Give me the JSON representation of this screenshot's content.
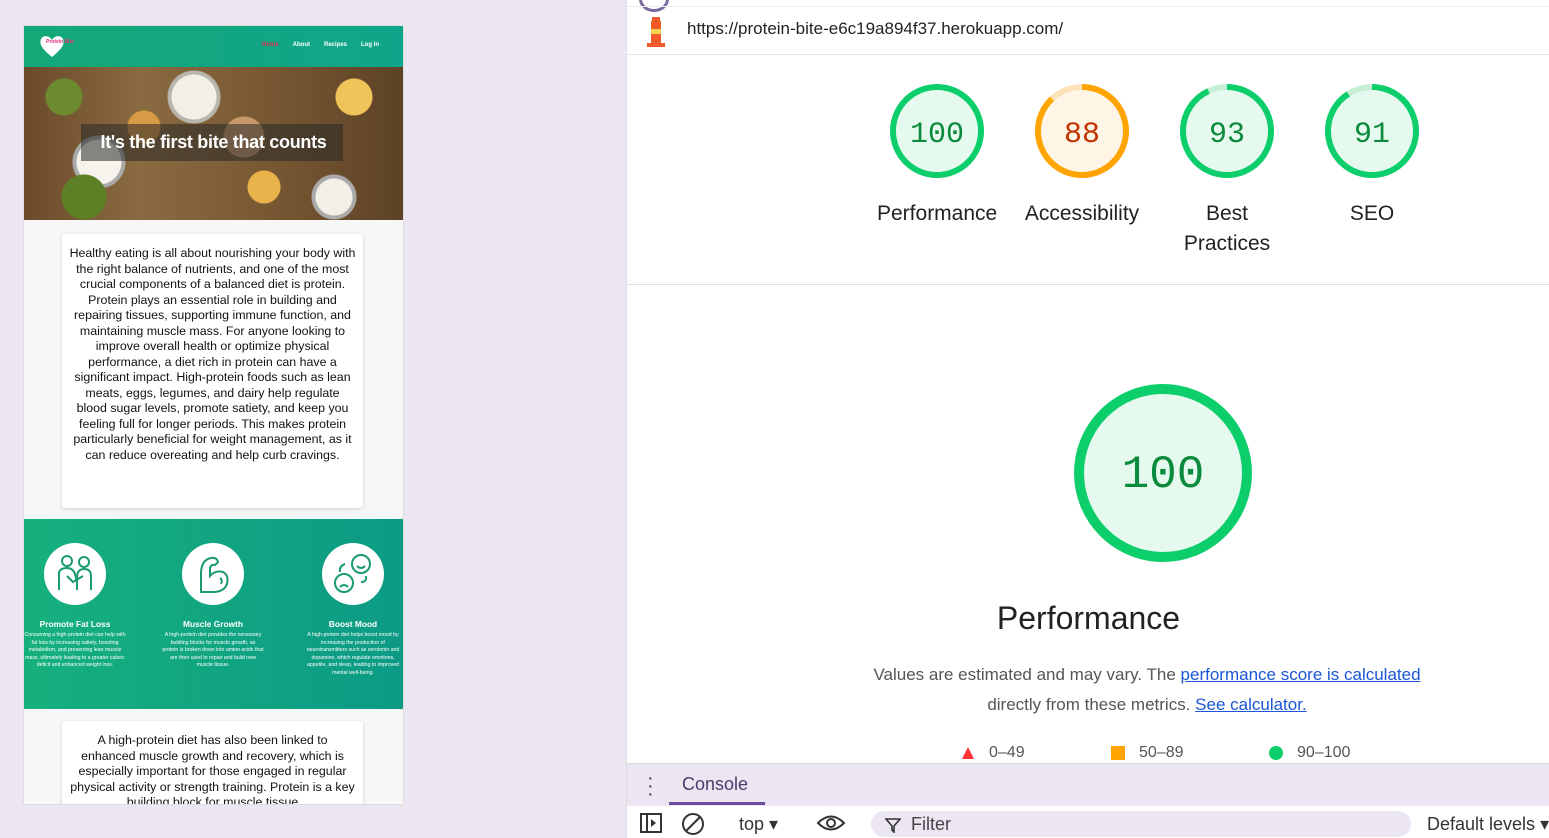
{
  "site": {
    "logo_text": "Protein Bite",
    "nav": [
      "Home",
      "About",
      "Recipes",
      "Log In"
    ],
    "hero_title": "It's the first bite that counts",
    "intro": "Healthy eating is all about nourishing your body with the right balance of nutrients, and one of the most crucial components of a balanced diet is protein. Protein plays an essential role in building and repairing tissues, supporting immune function, and maintaining muscle mass. For anyone looking to improve overall health or optimize physical performance, a diet rich in protein can have a significant impact. High-protein foods such as lean meats, eggs, legumes, and dairy help regulate blood sugar levels, promote satiety, and keep you feeling full for longer periods. This makes protein particularly beneficial for weight management, as it can reduce overeating and help curb cravings.",
    "benefits": [
      {
        "title": "Promote Fat Loss",
        "text": "Consuming a high-protein diet can help with fat loss by increasing satiety, boosting metabolism, and preserving lean muscle mass, ultimately leading to a greater caloric deficit and enhanced weight loss.",
        "icon": "people-icon"
      },
      {
        "title": "Muscle Growth",
        "text": "A high-protein diet provides the necessary building blocks for muscle growth, as protein is broken down into amino acids that are then used to repair and build new muscle tissue.",
        "icon": "flexed-arm-icon"
      },
      {
        "title": "Boost Mood",
        "text": "A high-protein diet helps boost mood by increasing the production of neurotransmitters such as serotonin and dopamine, which regulate emotions, appetite, and sleep, leading to improved mental well-being.",
        "icon": "mood-faces-icon"
      }
    ],
    "second": "A high-protein diet has also been linked to enhanced muscle growth and recovery, which is especially important for those engaged in regular physical activity or strength training. Protein is a key building block for muscle tissue"
  },
  "lighthouse": {
    "url": "https://protein-bite-e6c19a894f37.herokuapp.com/",
    "scores": [
      {
        "value": "100",
        "label": "Performance",
        "score": 100,
        "color": "#0cce6b",
        "bg": "#e6f9ee",
        "text": "#0a8a3c"
      },
      {
        "value": "88",
        "label": "Accessibility",
        "score": 88,
        "color": "#ffa400",
        "bg": "#fff5e6",
        "text": "#c33300"
      },
      {
        "value": "93",
        "label": "Best Practices",
        "score": 93,
        "color": "#0cce6b",
        "bg": "#e6f9ee",
        "text": "#0a8a3c"
      },
      {
        "value": "91",
        "label": "SEO",
        "score": 91,
        "color": "#0cce6b",
        "bg": "#e6f9ee",
        "text": "#0a8a3c"
      }
    ],
    "big_score": "100",
    "big_title": "Performance",
    "desc_prefix": "Values are estimated and may vary. The ",
    "desc_link": "performance score is calculated",
    "desc_mid": "directly from these metrics. ",
    "desc_link2": "See calculator.",
    "legend": [
      "0–49",
      "50–89",
      "90–100"
    ]
  },
  "devtools": {
    "tab": "Console",
    "context": "top",
    "filter": "Filter",
    "levels": "Default levels"
  }
}
